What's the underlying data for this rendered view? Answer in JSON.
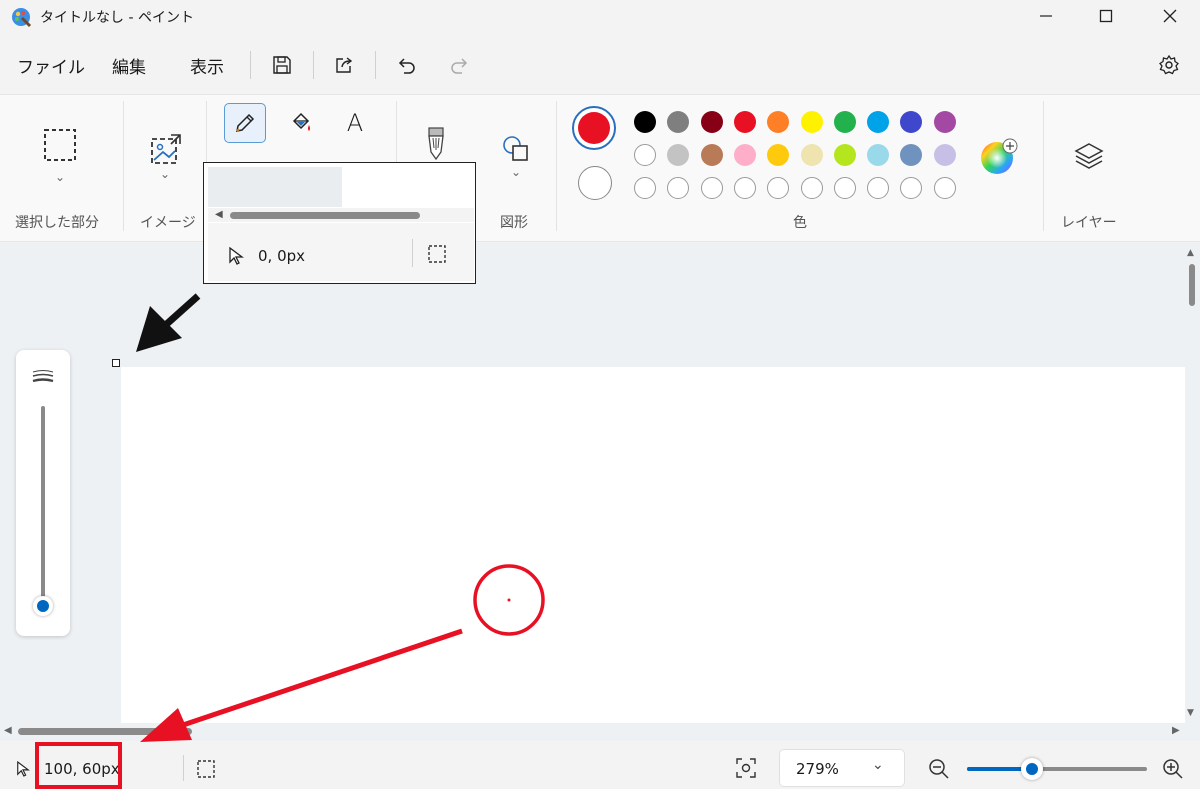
{
  "window": {
    "title": "タイトルなし - ペイント"
  },
  "menu": {
    "file": "ファイル",
    "edit": "編集",
    "view": "表示"
  },
  "ribbon": {
    "selection_label": "選択した部分",
    "image_label": "イメージ",
    "shapes_label": "図形",
    "colors_label": "色",
    "layers_label": "レイヤー",
    "text_tool_glyph": "A"
  },
  "colors": {
    "primary": "#e81123",
    "secondary": "#ffffff",
    "palette_row1": [
      "#000000",
      "#7f7f7f",
      "#880015",
      "#e81123",
      "#ff7f27",
      "#fff200",
      "#22b14c",
      "#00a2e8",
      "#3f48cc",
      "#a349a4"
    ],
    "palette_row2": [
      "#ffffff",
      "#c3c3c3",
      "#b97a57",
      "#ffaec9",
      "#ffc90e",
      "#efe4b0",
      "#b5e61d",
      "#99d9ea",
      "#7092be",
      "#c8bfe7"
    ],
    "palette_row3_empty": 10
  },
  "popup": {
    "coord": "0, 0px"
  },
  "status": {
    "coord": "100, 60px",
    "zoom": "279%",
    "zoom_level": 0.36
  },
  "annotation_color": "#e81123"
}
